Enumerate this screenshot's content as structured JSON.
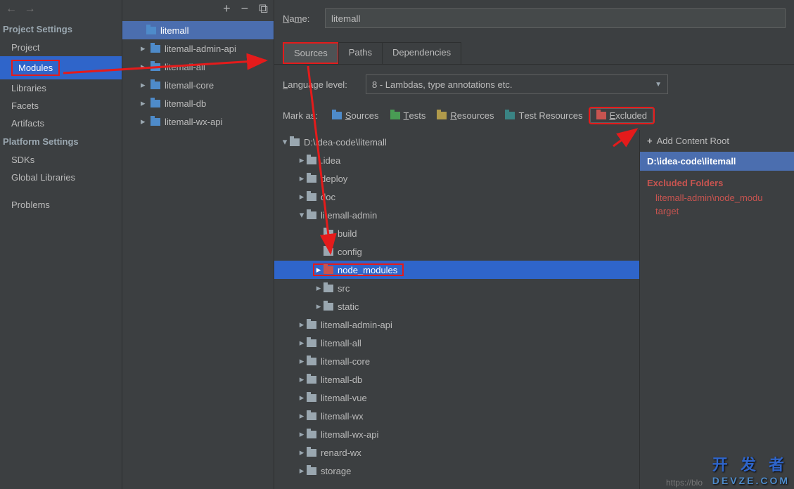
{
  "sidebar": {
    "project_settings_label": "Project Settings",
    "platform_settings_label": "Platform Settings",
    "items_project": "Project",
    "items_modules": "Modules",
    "items_libraries": "Libraries",
    "items_facets": "Facets",
    "items_artifacts": "Artifacts",
    "items_sdks": "SDKs",
    "items_global_libs": "Global Libraries",
    "items_problems": "Problems"
  },
  "modules": {
    "root": "litemall",
    "children": [
      "litemall-admin-api",
      "litemall-all",
      "litemall-core",
      "litemall-db",
      "litemall-wx-api"
    ]
  },
  "name_label": "Name:",
  "name_value": "litemall",
  "tabs": {
    "sources": "Sources",
    "paths": "Paths",
    "deps": "Dependencies"
  },
  "lang_label": "Language level:",
  "lang_value": "8 - Lambdas, type annotations etc.",
  "mark_label": "Mark as:",
  "marks": {
    "sources": "Sources",
    "tests": "Tests",
    "resources": "Resources",
    "test_resources": "Test Resources",
    "excluded": "Excluded"
  },
  "tree": {
    "root": "D:\\idea-code\\litemall",
    "n_idea": ".idea",
    "n_deploy": "deploy",
    "n_doc": "doc",
    "n_admin": "litemall-admin",
    "n_build": "build",
    "n_config": "config",
    "n_node": "node_modules",
    "n_src": "src",
    "n_static": "static",
    "n_admin_api": "litemall-admin-api",
    "n_all": "litemall-all",
    "n_core": "litemall-core",
    "n_db": "litemall-db",
    "n_vue": "litemall-vue",
    "n_wx": "litemall-wx",
    "n_wx_api": "litemall-wx-api",
    "n_renard": "renard-wx",
    "n_storage": "storage"
  },
  "right": {
    "add_root": "Add Content Root",
    "root_path": "D:\\idea-code\\litemall",
    "excluded_head": "Excluded Folders",
    "excluded_items": [
      "litemall-admin\\node_modu",
      "target"
    ]
  },
  "watermark": {
    "line1": "开 发 者",
    "line2": "DEVZE.COM"
  },
  "footer": "https://blo"
}
